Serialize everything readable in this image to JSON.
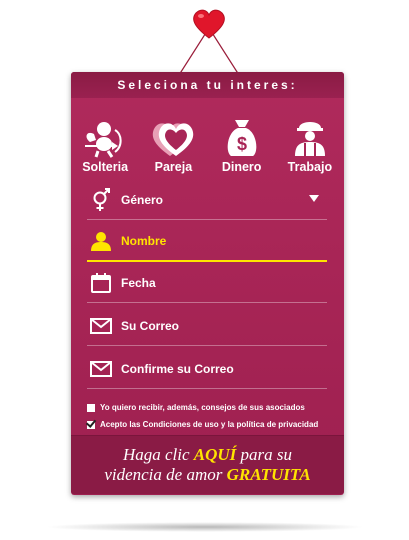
{
  "title": "Seleciona tu interes:",
  "interests": [
    {
      "label": "Solteria",
      "icon": "cupid-icon"
    },
    {
      "label": "Pareja",
      "icon": "hearts-icon"
    },
    {
      "label": "Dinero",
      "icon": "money-bag-icon"
    },
    {
      "label": "Trabajo",
      "icon": "worker-icon"
    }
  ],
  "fields": {
    "gender": {
      "label": "Género",
      "icon": "gender-icon"
    },
    "name": {
      "label": "Nombre",
      "icon": "user-icon"
    },
    "date": {
      "label": "Fecha",
      "icon": "calendar-icon"
    },
    "email": {
      "label": "Su Correo",
      "icon": "envelope-icon"
    },
    "email_confirm": {
      "label": "Confirme su Correo",
      "icon": "envelope-icon"
    }
  },
  "checkboxes": [
    {
      "label": "Yo quiero recibir, además, consejos de sus asociados",
      "checked": false
    },
    {
      "label": "Acepto las Condiciones de uso y la política de privacidad",
      "checked": true
    }
  ],
  "cta": {
    "line1_a": "Haga clic ",
    "line1_b": "AQUÍ",
    "line1_c": " para su",
    "line2_a": "videncia de amor ",
    "line2_b": "GRATUITA"
  },
  "colors": {
    "accent": "#ffe400",
    "card": "#a82556",
    "heart": "#e0162b"
  }
}
